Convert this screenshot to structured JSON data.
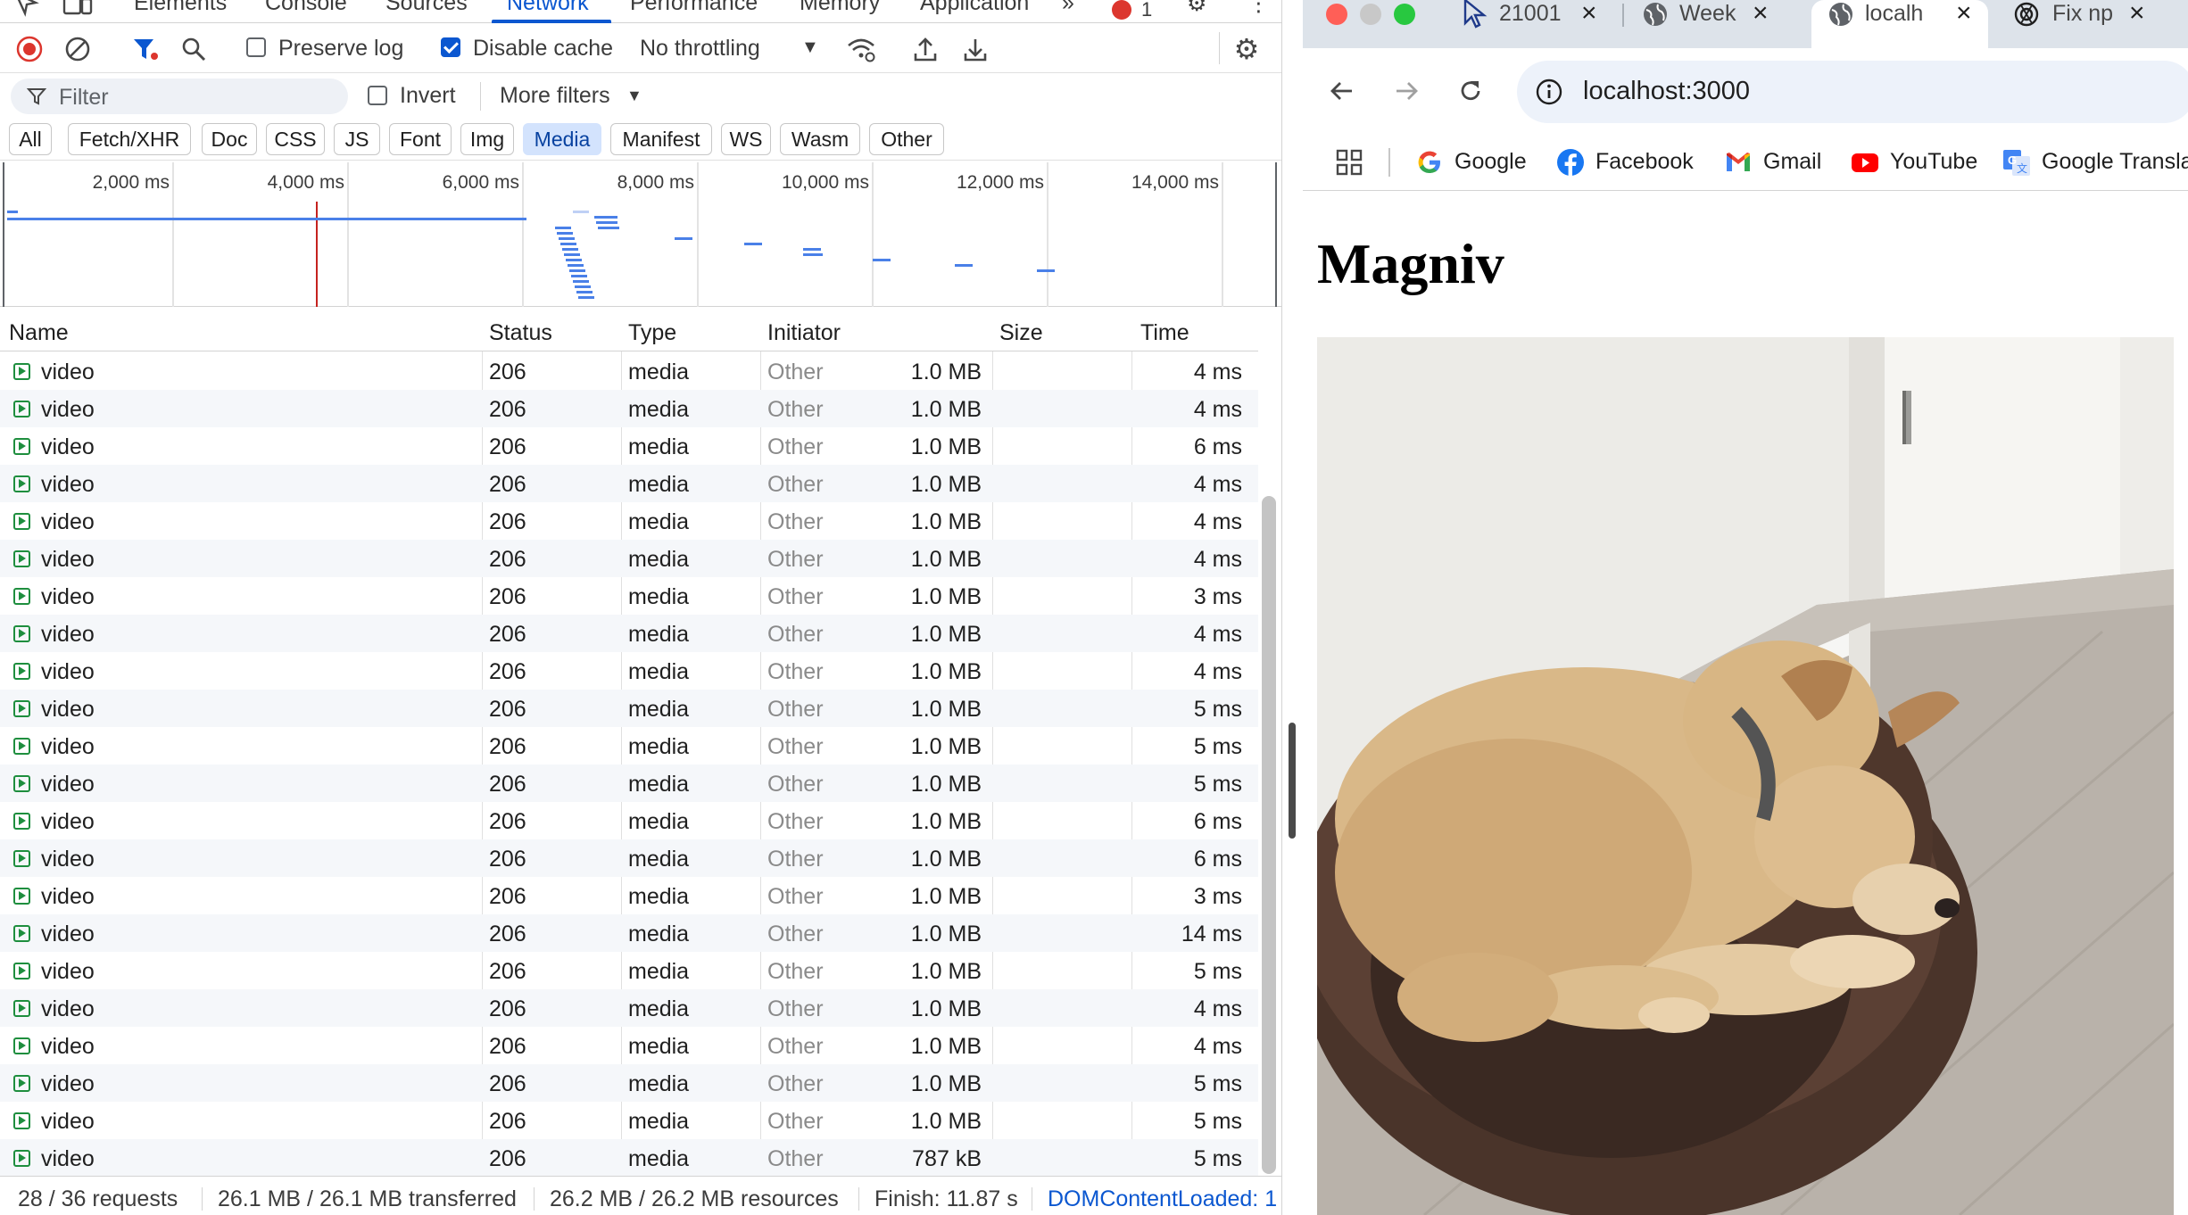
{
  "devtools": {
    "tabs": [
      "Elements",
      "Console",
      "Sources",
      "Network",
      "Performance",
      "Memory",
      "Application"
    ],
    "error_count": "1",
    "toolbar": {
      "preserve_log": "Preserve log",
      "preserve_log_checked": false,
      "disable_cache": "Disable cache",
      "disable_cache_checked": true,
      "throttling": "No throttling"
    },
    "filter": {
      "placeholder": "Filter",
      "invert": "Invert",
      "more_filters": "More filters"
    },
    "type_filters": [
      "All",
      "Fetch/XHR",
      "Doc",
      "CSS",
      "JS",
      "Font",
      "Img",
      "Media",
      "Manifest",
      "WS",
      "Wasm",
      "Other"
    ],
    "active_type_filter": "Media",
    "timeline_ticks": [
      "2,000 ms",
      "4,000 ms",
      "6,000 ms",
      "8,000 ms",
      "10,000 ms",
      "12,000 ms",
      "14,000 ms"
    ],
    "columns": [
      "Name",
      "Status",
      "Type",
      "Initiator",
      "Size",
      "Time"
    ],
    "rows": [
      {
        "name": "video",
        "status": "206",
        "type": "media",
        "initiator": "Other",
        "size": "1.0 MB",
        "time": "4 ms"
      },
      {
        "name": "video",
        "status": "206",
        "type": "media",
        "initiator": "Other",
        "size": "1.0 MB",
        "time": "4 ms"
      },
      {
        "name": "video",
        "status": "206",
        "type": "media",
        "initiator": "Other",
        "size": "1.0 MB",
        "time": "6 ms"
      },
      {
        "name": "video",
        "status": "206",
        "type": "media",
        "initiator": "Other",
        "size": "1.0 MB",
        "time": "4 ms"
      },
      {
        "name": "video",
        "status": "206",
        "type": "media",
        "initiator": "Other",
        "size": "1.0 MB",
        "time": "4 ms"
      },
      {
        "name": "video",
        "status": "206",
        "type": "media",
        "initiator": "Other",
        "size": "1.0 MB",
        "time": "4 ms"
      },
      {
        "name": "video",
        "status": "206",
        "type": "media",
        "initiator": "Other",
        "size": "1.0 MB",
        "time": "3 ms"
      },
      {
        "name": "video",
        "status": "206",
        "type": "media",
        "initiator": "Other",
        "size": "1.0 MB",
        "time": "4 ms"
      },
      {
        "name": "video",
        "status": "206",
        "type": "media",
        "initiator": "Other",
        "size": "1.0 MB",
        "time": "4 ms"
      },
      {
        "name": "video",
        "status": "206",
        "type": "media",
        "initiator": "Other",
        "size": "1.0 MB",
        "time": "5 ms"
      },
      {
        "name": "video",
        "status": "206",
        "type": "media",
        "initiator": "Other",
        "size": "1.0 MB",
        "time": "5 ms"
      },
      {
        "name": "video",
        "status": "206",
        "type": "media",
        "initiator": "Other",
        "size": "1.0 MB",
        "time": "5 ms"
      },
      {
        "name": "video",
        "status": "206",
        "type": "media",
        "initiator": "Other",
        "size": "1.0 MB",
        "time": "6 ms"
      },
      {
        "name": "video",
        "status": "206",
        "type": "media",
        "initiator": "Other",
        "size": "1.0 MB",
        "time": "6 ms"
      },
      {
        "name": "video",
        "status": "206",
        "type": "media",
        "initiator": "Other",
        "size": "1.0 MB",
        "time": "3 ms"
      },
      {
        "name": "video",
        "status": "206",
        "type": "media",
        "initiator": "Other",
        "size": "1.0 MB",
        "time": "14 ms"
      },
      {
        "name": "video",
        "status": "206",
        "type": "media",
        "initiator": "Other",
        "size": "1.0 MB",
        "time": "5 ms"
      },
      {
        "name": "video",
        "status": "206",
        "type": "media",
        "initiator": "Other",
        "size": "1.0 MB",
        "time": "4 ms"
      },
      {
        "name": "video",
        "status": "206",
        "type": "media",
        "initiator": "Other",
        "size": "1.0 MB",
        "time": "4 ms"
      },
      {
        "name": "video",
        "status": "206",
        "type": "media",
        "initiator": "Other",
        "size": "1.0 MB",
        "time": "5 ms"
      },
      {
        "name": "video",
        "status": "206",
        "type": "media",
        "initiator": "Other",
        "size": "1.0 MB",
        "time": "5 ms"
      },
      {
        "name": "video",
        "status": "206",
        "type": "media",
        "initiator": "Other",
        "size": "787 kB",
        "time": "5 ms"
      }
    ],
    "status_bar": {
      "requests": "28 / 36 requests",
      "transferred": "26.1 MB / 26.1 MB transferred",
      "resources": "26.2 MB / 26.2 MB resources",
      "finish": "Finish: 11.87 s",
      "dom_content_loaded": "DOMContentLoaded: 1"
    }
  },
  "browser": {
    "tabs": [
      {
        "title": "21001",
        "icon": "cursor-app-icon"
      },
      {
        "title": "Week",
        "icon": "globe-icon"
      },
      {
        "title": "localh",
        "icon": "globe-icon",
        "active": true
      },
      {
        "title": "Fix np",
        "icon": "openai-icon"
      }
    ],
    "url": "localhost:3000",
    "bookmarks": [
      {
        "label": "Google",
        "icon": "google-icon"
      },
      {
        "label": "Facebook",
        "icon": "facebook-icon"
      },
      {
        "label": "Gmail",
        "icon": "gmail-icon"
      },
      {
        "label": "YouTube",
        "icon": "youtube-icon"
      },
      {
        "label": "Google Transla",
        "icon": "google-translate-icon"
      }
    ],
    "page": {
      "heading": "Magniv",
      "media": "video-player"
    }
  },
  "colors": {
    "accent": "#0b57d0",
    "chip_active_bg": "#d3e3fd",
    "waterfall_bar": "#4a80e8",
    "dcl_line": "#c5221f",
    "status_ok": "#1e8e3e"
  }
}
